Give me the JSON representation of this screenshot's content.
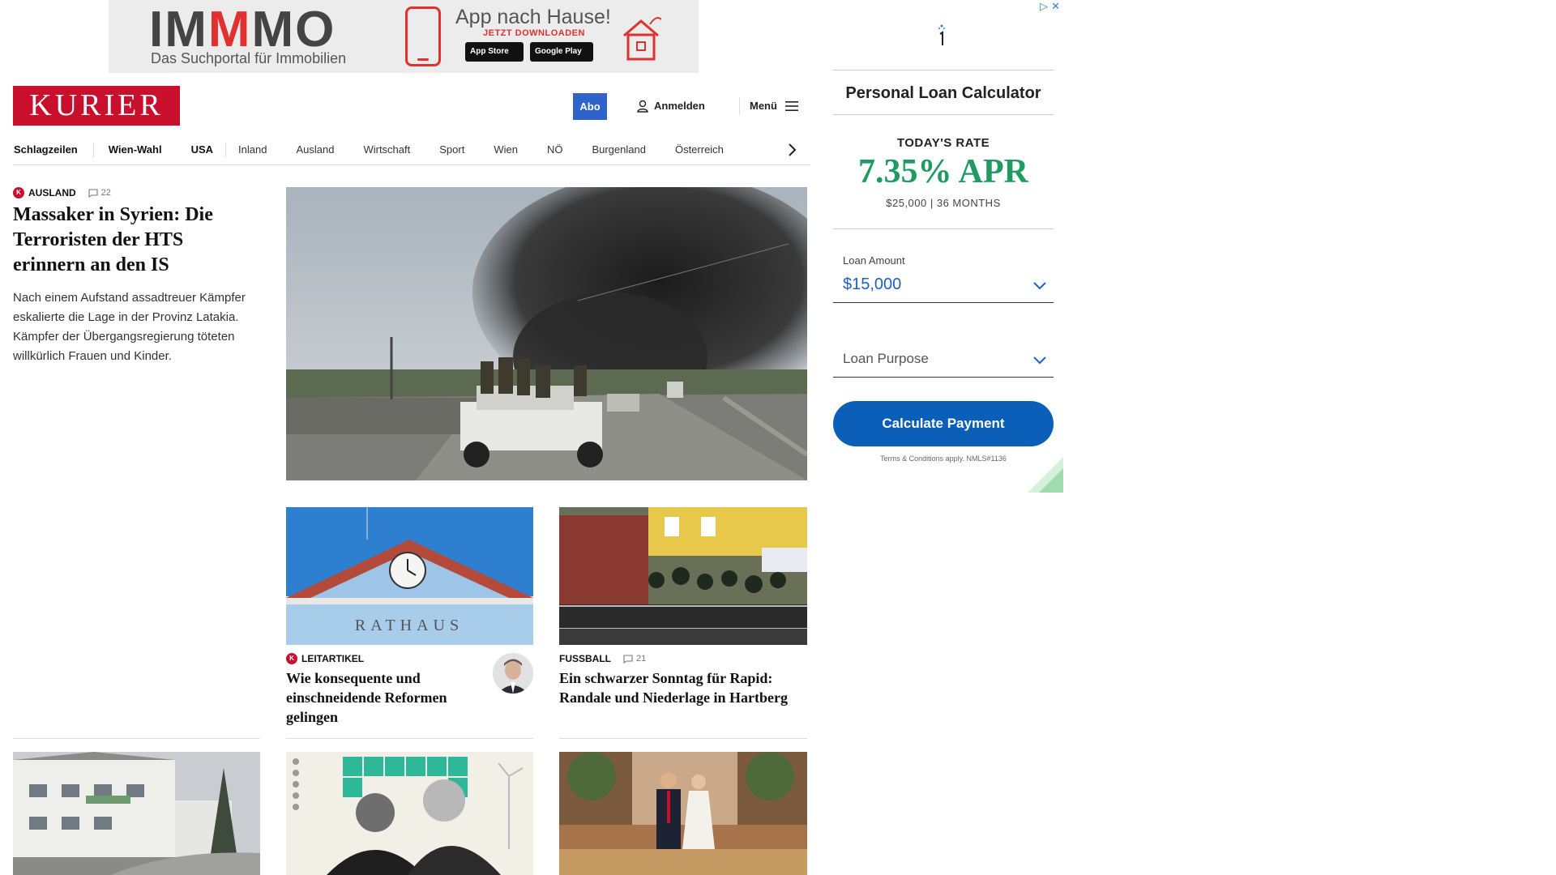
{
  "banner_ad": {
    "brand_im": "IM",
    "brand_mm": "M",
    "brand_mo": "MO",
    "tagline": "Das Suchportal für Immobilien",
    "app_title": "App nach Hause!",
    "app_cta": "JETZT DOWNLOADEN",
    "store_apple": "App Store",
    "store_google": "Google Play"
  },
  "header": {
    "logo": "KURIER",
    "abo": "Abo",
    "login": "Anmelden",
    "menu": "Menü"
  },
  "nav": {
    "items": [
      "Schlagzeilen",
      "Wien-Wahl",
      "USA",
      "Inland",
      "Ausland",
      "Wirtschaft",
      "Sport",
      "Wien",
      "NÖ",
      "Burgenland",
      "Österreich"
    ]
  },
  "lead": {
    "kicker": "AUSLAND",
    "comments": "22",
    "title": "Massaker in Syrien: Die Terroristen der HTS erinnern an den IS",
    "teaser": "Nach einem Aufstand assadtreuer Kämpfer eskalierte die Lage in der Provinz Latakia. Kämpfer der Übergangsregierung töteten willkürlich Frauen und Kinder.",
    "image_alt": "Pickup mit Kämpfern vor schwarzer Rauchsäule"
  },
  "cards": [
    {
      "kicker": "LEITARTIKEL",
      "title": "Wie konsequente und einschneidende Reformen gelingen",
      "image_text": "RATHAUS"
    },
    {
      "kicker": "FUSSBALL",
      "comments": "21",
      "title": "Ein schwarzer Sonntag für Rapid: Randale und Niederlage in Hartberg"
    }
  ],
  "sidebar_ad": {
    "title": "Personal Loan Calculator",
    "rate_label": "TODAY'S RATE",
    "rate_value": "7.35% APR",
    "rate_sub": "$25,000 | 36 MONTHS",
    "loan_amount_label": "Loan Amount",
    "loan_amount_value": "$15,000",
    "loan_purpose": "Loan Purpose",
    "button": "Calculate Payment",
    "terms": "Terms & Conditions apply. NMLS#1136"
  },
  "colors": {
    "brand_red": "#c8102e",
    "abo_blue": "#2f63c9",
    "rate_green": "#1f9b62",
    "button_blue": "#0b5fb8"
  }
}
